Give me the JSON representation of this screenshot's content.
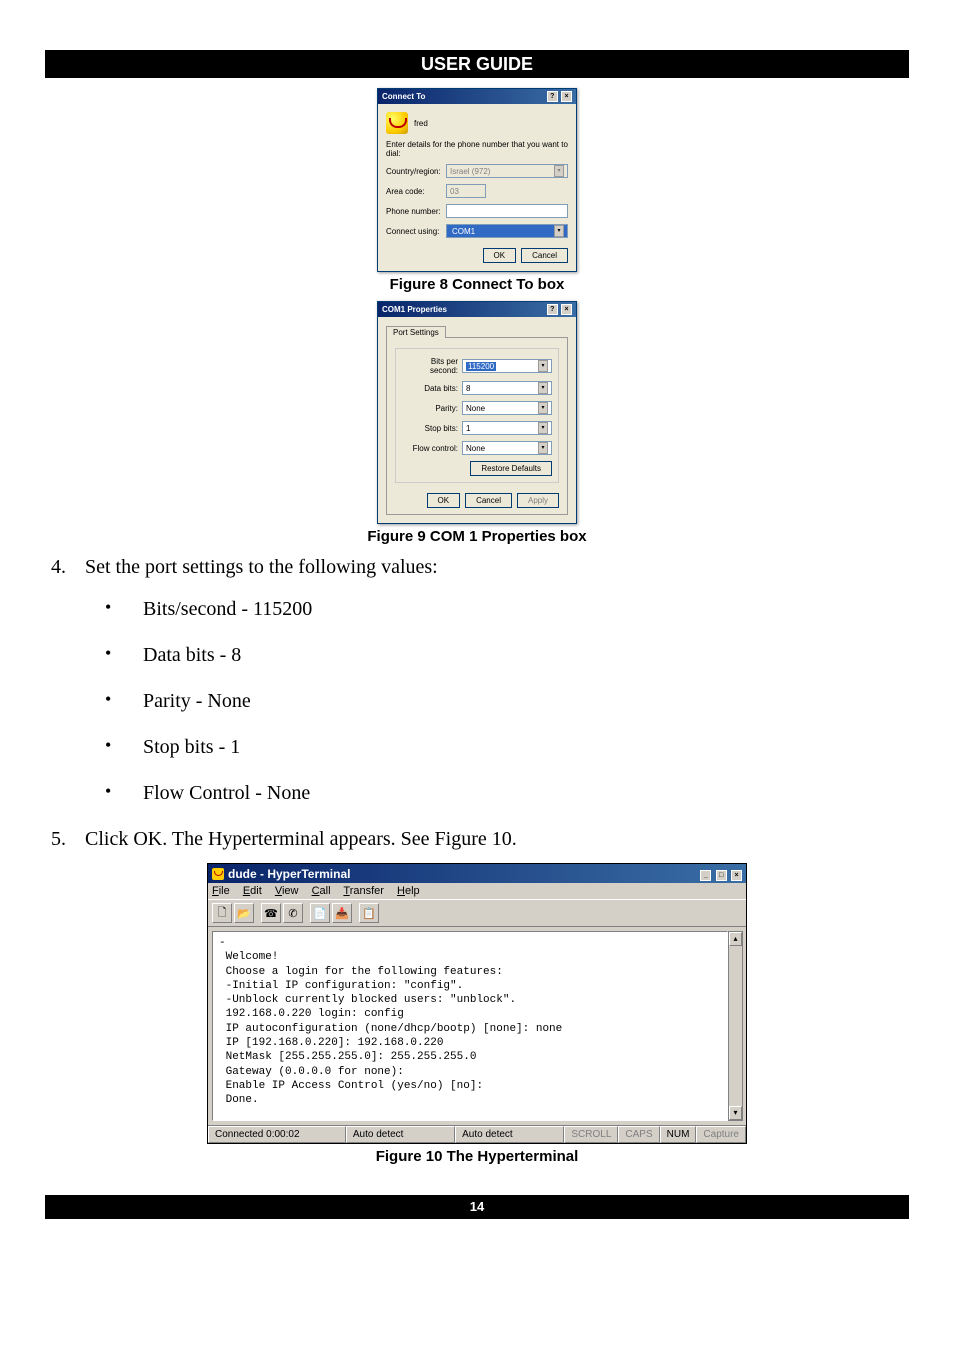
{
  "header_title": "USER GUIDE",
  "connect_to": {
    "title": "Connect To",
    "icon": "phone-icon",
    "name": "fred",
    "instructions": "Enter details for the phone number that you want to dial:",
    "fields": {
      "country_label": "Country/region:",
      "country_value": "Israel (972)",
      "area_label": "Area code:",
      "area_value": "03",
      "phone_label": "Phone number:",
      "phone_value": "",
      "connect_label": "Connect using:",
      "connect_value": "COM1"
    },
    "buttons": {
      "ok": "OK",
      "cancel": "Cancel"
    }
  },
  "figure8_caption": "Figure 8 Connect To box",
  "com1": {
    "title": "COM1 Properties",
    "tab": "Port Settings",
    "fields": {
      "bps_label": "Bits per second:",
      "bps_value": "115200",
      "data_label": "Data bits:",
      "data_value": "8",
      "parity_label": "Parity:",
      "parity_value": "None",
      "stop_label": "Stop bits:",
      "stop_value": "1",
      "flow_label": "Flow control:",
      "flow_value": "None"
    },
    "restore": "Restore Defaults",
    "buttons": {
      "ok": "OK",
      "cancel": "Cancel",
      "apply": "Apply"
    }
  },
  "figure9_caption": "Figure 9 COM 1 Properties box",
  "step4_text": "Set the port settings to the following values:",
  "bullets": [
    "Bits/second - 115200",
    "Data bits - 8",
    "Parity - None",
    "Stop bits - 1",
    "Flow Control - None"
  ],
  "step5_text": "Click OK. The Hyperterminal appears. See Figure 10.",
  "hyperterminal": {
    "title": "dude - HyperTerminal",
    "menus": [
      "File",
      "Edit",
      "View",
      "Call",
      "Transfer",
      "Help"
    ],
    "toolbar_icons": [
      "new-icon",
      "open-icon",
      "connect-icon",
      "disconnect-icon",
      "send-icon",
      "receive-icon",
      "properties-icon"
    ],
    "content_lines": [
      "-",
      " Welcome!",
      " Choose a login for the following features:",
      " -Initial IP configuration: \"config\".",
      " -Unblock currently blocked users: \"unblock\".",
      " 192.168.0.220 login: config",
      " IP autoconfiguration (none/dhcp/bootp) [none]: none",
      " IP [192.168.0.220]: 192.168.0.220",
      " NetMask [255.255.255.0]: 255.255.255.0",
      " Gateway (0.0.0.0 for none):",
      " Enable IP Access Control (yes/no) [no]:",
      " Done."
    ],
    "status": {
      "connected": "Connected 0:00:02",
      "detect1": "Auto detect",
      "detect2": "Auto detect",
      "scroll": "SCROLL",
      "caps": "CAPS",
      "num": "NUM",
      "capture": "Capture"
    }
  },
  "figure10_caption": "Figure 10 The Hyperterminal",
  "page_number": "14"
}
